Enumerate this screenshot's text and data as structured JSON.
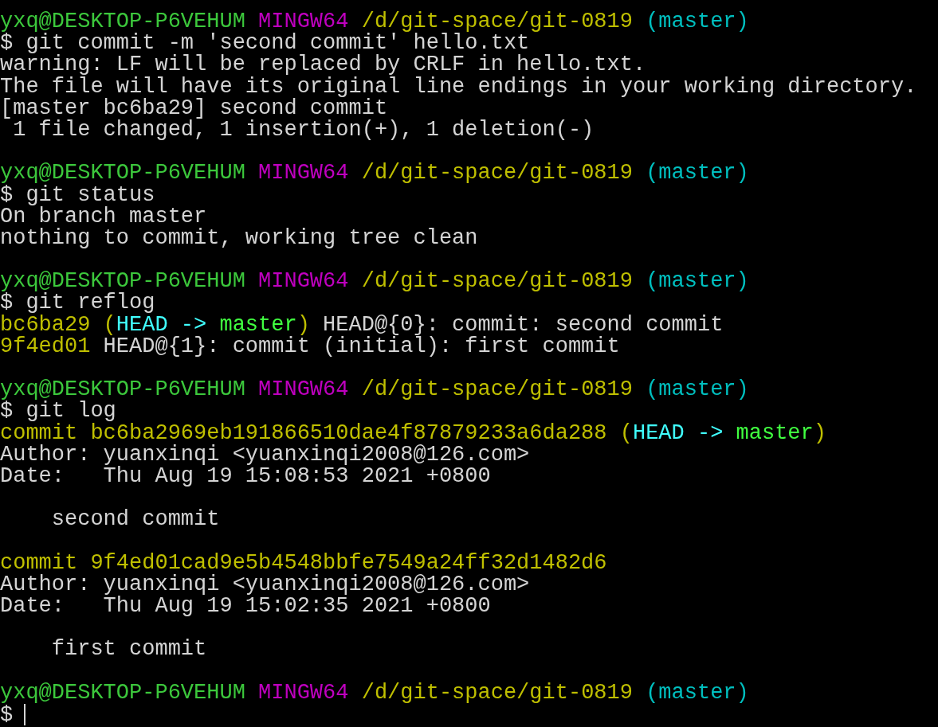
{
  "terminal": {
    "lines": [
      {
        "kind": "prompt",
        "user": "yxq@DESKTOP-P6VEHUM",
        "system": "MINGW64",
        "path": "/d/git-space/git-0819",
        "branch": "(master)"
      },
      {
        "kind": "command",
        "text": "$ git commit -m 'second commit' hello.txt"
      },
      {
        "kind": "output",
        "text": "warning: LF will be replaced by CRLF in hello.txt."
      },
      {
        "kind": "output",
        "text": "The file will have its original line endings in your working directory."
      },
      {
        "kind": "output",
        "text": "[master bc6ba29] second commit"
      },
      {
        "kind": "output",
        "text": " 1 file changed, 1 insertion(+), 1 deletion(-)"
      },
      {
        "kind": "blank"
      },
      {
        "kind": "prompt",
        "user": "yxq@DESKTOP-P6VEHUM",
        "system": "MINGW64",
        "path": "/d/git-space/git-0819",
        "branch": "(master)"
      },
      {
        "kind": "command",
        "text": "$ git status"
      },
      {
        "kind": "output",
        "text": "On branch master"
      },
      {
        "kind": "output",
        "text": "nothing to commit, working tree clean"
      },
      {
        "kind": "blank"
      },
      {
        "kind": "prompt",
        "user": "yxq@DESKTOP-P6VEHUM",
        "system": "MINGW64",
        "path": "/d/git-space/git-0819",
        "branch": "(master)"
      },
      {
        "kind": "command",
        "text": "$ git reflog"
      },
      {
        "kind": "colored",
        "segments": [
          {
            "text": "bc6ba29 (",
            "color": "#bfbf00"
          },
          {
            "text": "HEAD ->",
            "color": "#40ffff"
          },
          {
            "text": " master",
            "color": "#40ff40"
          },
          {
            "text": ")",
            "color": "#bfbf00"
          },
          {
            "text": " HEAD@{0}: commit: second commit",
            "color": "#d4d4d4"
          }
        ]
      },
      {
        "kind": "colored",
        "segments": [
          {
            "text": "9f4ed01",
            "color": "#bfbf00"
          },
          {
            "text": " HEAD@{1}: commit (initial): first commit",
            "color": "#d4d4d4"
          }
        ]
      },
      {
        "kind": "blank"
      },
      {
        "kind": "prompt",
        "user": "yxq@DESKTOP-P6VEHUM",
        "system": "MINGW64",
        "path": "/d/git-space/git-0819",
        "branch": "(master)"
      },
      {
        "kind": "command",
        "text": "$ git log"
      },
      {
        "kind": "colored",
        "segments": [
          {
            "text": "commit bc6ba2969eb191866510dae4f87879233a6da288 (",
            "color": "#bfbf00"
          },
          {
            "text": "HEAD ->",
            "color": "#40ffff"
          },
          {
            "text": " master",
            "color": "#40ff40"
          },
          {
            "text": ")",
            "color": "#bfbf00"
          }
        ]
      },
      {
        "kind": "output",
        "text": "Author: yuanxinqi <yuanxinqi2008@126.com>"
      },
      {
        "kind": "output",
        "text": "Date:   Thu Aug 19 15:08:53 2021 +0800"
      },
      {
        "kind": "blank"
      },
      {
        "kind": "output",
        "text": "    second commit"
      },
      {
        "kind": "blank"
      },
      {
        "kind": "colored",
        "segments": [
          {
            "text": "commit 9f4ed01cad9e5b4548bbfe7549a24ff32d1482d6",
            "color": "#bfbf00"
          }
        ]
      },
      {
        "kind": "output",
        "text": "Author: yuanxinqi <yuanxinqi2008@126.com>"
      },
      {
        "kind": "output",
        "text": "Date:   Thu Aug 19 15:02:35 2021 +0800"
      },
      {
        "kind": "blank"
      },
      {
        "kind": "output",
        "text": "    first commit"
      },
      {
        "kind": "blank"
      },
      {
        "kind": "prompt",
        "user": "yxq@DESKTOP-P6VEHUM",
        "system": "MINGW64",
        "path": "/d/git-space/git-0819",
        "branch": "(master)"
      },
      {
        "kind": "cursor",
        "text": "$"
      }
    ]
  }
}
